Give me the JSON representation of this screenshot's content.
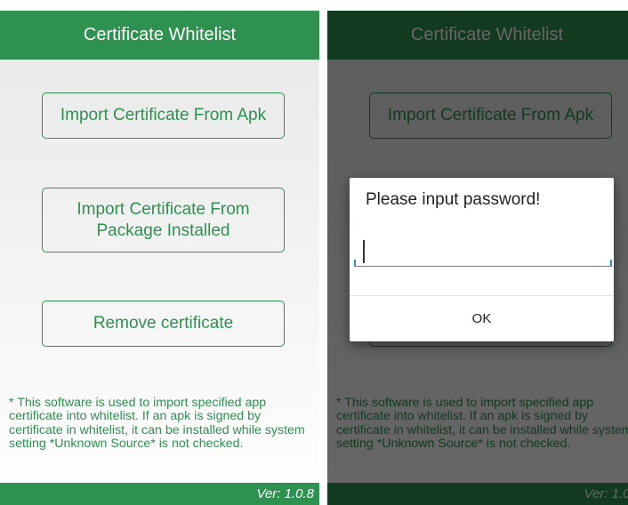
{
  "app": {
    "title": "Certificate Whitelist",
    "buttons": {
      "import_apk": "Import Certificate From Apk",
      "import_installed": "Import Certificate From Package Installed",
      "remove": "Remove certificate"
    },
    "info_text": "* This software is used to import specified app certificate into whitelist. If an apk is signed by certificate in whitelist, it can be installed while system setting *Unknown Source* is not checked.",
    "version": "Ver: 1.0.8"
  },
  "dialog": {
    "title": "Please input password!",
    "input_value": "",
    "ok_label": "OK"
  },
  "colors": {
    "brand_green": "#2e9150",
    "input_accent": "#2a95c5"
  }
}
